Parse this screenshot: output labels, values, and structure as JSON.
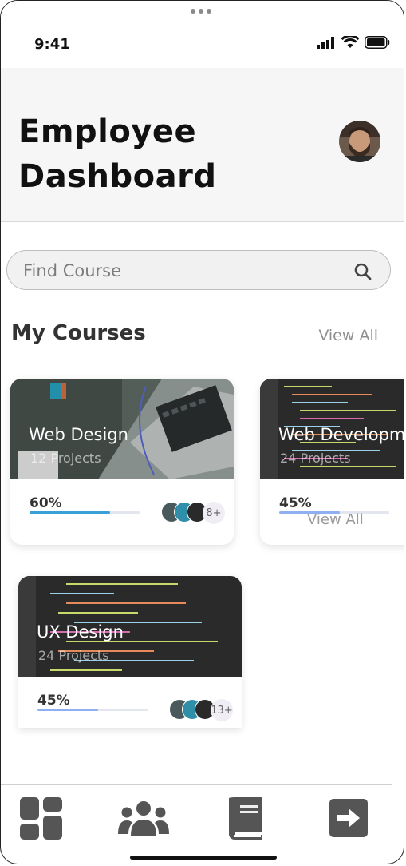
{
  "status": {
    "time": "9:41"
  },
  "header": {
    "title": "Employee Dashboard"
  },
  "search": {
    "placeholder": "Find Course"
  },
  "courses": {
    "section_title": "My Courses",
    "view_all": "View All",
    "items": [
      {
        "title": "Web Design",
        "subtitle": "12 Projects",
        "progress_label": "60%",
        "progress": 0.6,
        "progress_color": "#3aa0d8",
        "extra_count": "8+"
      },
      {
        "title": "Web Developm",
        "subtitle": "24 Projects",
        "progress_label": "45%",
        "progress": 0.45,
        "progress_color": "#8fb0f0",
        "overlay_link": "View All"
      },
      {
        "title": "UX Design",
        "subtitle": "24 Projects",
        "progress_label": "45%",
        "progress": 0.45,
        "progress_color": "#8fb0f0",
        "extra_count": "13+"
      }
    ]
  },
  "nav": {
    "items": [
      {
        "icon": "dashboard-grid-icon"
      },
      {
        "icon": "people-group-icon"
      },
      {
        "icon": "book-icon"
      },
      {
        "icon": "logout-arrow-icon"
      }
    ]
  },
  "colors": {
    "icon_gray": "#555555",
    "header_bg": "#f6f6f6"
  }
}
